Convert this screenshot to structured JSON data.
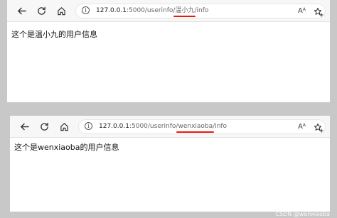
{
  "windows": [
    {
      "url_host": "127.0.0.1",
      "url_rest": ":5000/userinfo/",
      "url_param": "温小九",
      "url_tail": "/info",
      "page_text": "这个是温小九的用户信息"
    },
    {
      "url_host": "127.0.0.1",
      "url_rest": ":5000/userinfo/",
      "url_param": "wenxiaoba",
      "url_tail": "/info",
      "page_text": "这个是wenxiaoba的用户信息"
    }
  ],
  "icons": {
    "back": "back-arrow-icon",
    "refresh": "refresh-icon",
    "home": "home-icon",
    "info": "site-info-icon",
    "read_aloud": "read-aloud-icon",
    "favorite": "add-favorite-icon"
  },
  "colors": {
    "url_highlight": "#e8190d",
    "background": "#c8c8c8"
  },
  "watermark": "CSDN @wenxiaoba"
}
